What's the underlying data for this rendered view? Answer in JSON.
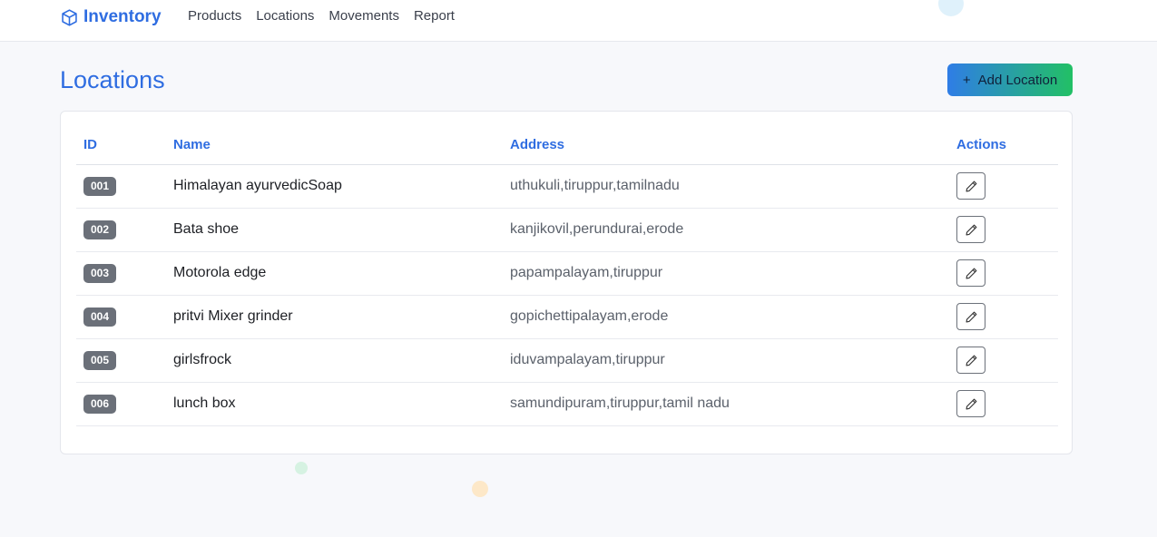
{
  "brand": {
    "name": "Inventory",
    "icon": "box-icon",
    "color": "#2f6de1"
  },
  "nav": {
    "links": [
      {
        "label": "Products"
      },
      {
        "label": "Locations"
      },
      {
        "label": "Movements"
      },
      {
        "label": "Report"
      }
    ]
  },
  "page": {
    "title": "Locations",
    "add_button": {
      "icon": "+",
      "label": "Add Location"
    }
  },
  "table": {
    "headers": {
      "id": "ID",
      "name": "Name",
      "address": "Address",
      "actions": "Actions"
    },
    "rows": [
      {
        "id": "001",
        "name": "Himalayan ayurvedicSoap",
        "address": "uthukuli,tiruppur,tamilnadu"
      },
      {
        "id": "002",
        "name": "Bata shoe",
        "address": "kanjikovil,perundurai,erode"
      },
      {
        "id": "003",
        "name": "Motorola edge",
        "address": "papampalayam,tiruppur"
      },
      {
        "id": "004",
        "name": "pritvi Mixer grinder",
        "address": "gopichettipalayam,erode"
      },
      {
        "id": "005",
        "name": "girlsfrock",
        "address": "iduvampalayam,tiruppur"
      },
      {
        "id": "006",
        "name": "lunch box",
        "address": "samundipuram,tiruppur,tamil nadu"
      }
    ],
    "row_action_icon": "pencil-icon"
  },
  "colors": {
    "accent": "#2f6de1",
    "button_gradient_start": "#2f7de6",
    "button_gradient_end": "#22c065",
    "badge": "#6b7079"
  }
}
